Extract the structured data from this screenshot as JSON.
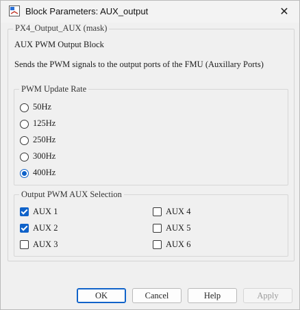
{
  "window": {
    "title": "Block Parameters: AUX_output",
    "close_icon": "close-icon"
  },
  "mask": {
    "legend": "PX4_Output_AUX (mask)",
    "block_name": "AUX PWM Output Block",
    "description": "Sends the PWM signals to the output ports of the FMU (Auxillary Ports)"
  },
  "pwm_rate": {
    "legend": "PWM Update Rate",
    "options": [
      {
        "label": "50Hz",
        "selected": false
      },
      {
        "label": "125Hz",
        "selected": false
      },
      {
        "label": "250Hz",
        "selected": false
      },
      {
        "label": "300Hz",
        "selected": false
      },
      {
        "label": "400Hz",
        "selected": true
      }
    ]
  },
  "aux_selection": {
    "legend": "Output PWM AUX Selection",
    "items": [
      {
        "label": "AUX 1",
        "checked": true
      },
      {
        "label": "AUX 2",
        "checked": true
      },
      {
        "label": "AUX 3",
        "checked": false
      },
      {
        "label": "AUX 4",
        "checked": false
      },
      {
        "label": "AUX 5",
        "checked": false
      },
      {
        "label": "AUX 6",
        "checked": false
      }
    ]
  },
  "buttons": {
    "ok": "OK",
    "cancel": "Cancel",
    "help": "Help",
    "apply": "Apply"
  },
  "colors": {
    "accent": "#0f62c9",
    "background": "#f0f0f0"
  }
}
